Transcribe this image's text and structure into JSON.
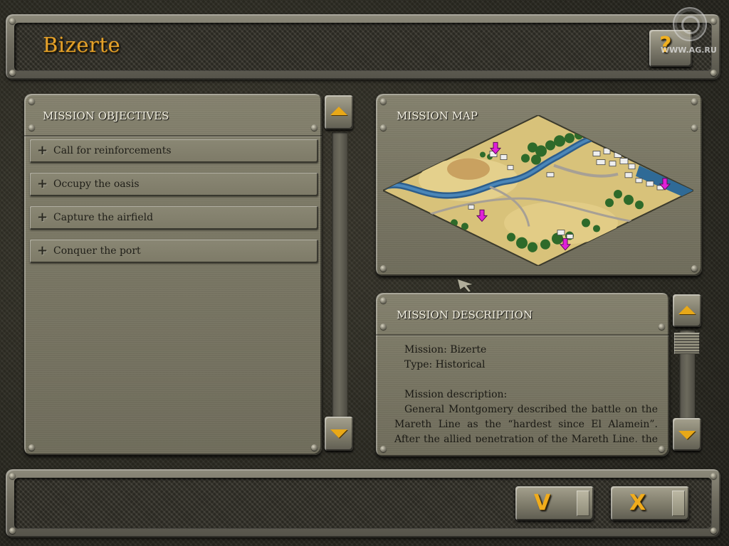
{
  "header": {
    "title": "Bizerte",
    "help_glyph": "?"
  },
  "watermark": {
    "text": "WWW.AG.RU",
    "logo_icon": "ag-logo-icon"
  },
  "objectives": {
    "heading": "MISSION OBJECTIVES",
    "items": [
      {
        "label": "Call for reinforcements"
      },
      {
        "label": "Occupy the oasis"
      },
      {
        "label": "Capture the airfield"
      },
      {
        "label": "Conquer the port"
      }
    ],
    "expand_glyph": "+"
  },
  "map": {
    "heading": "MISSION MAP",
    "markers_color": "#e020d8"
  },
  "description": {
    "heading": "MISSION DESCRIPTION",
    "mission_line": "Mission: Bizerte",
    "type_line": "Type: Historical",
    "desc_label": "Mission description:",
    "body_line1": "General Montgomery described the battle on the",
    "body_line2": "Mareth Line as the “hardest since El Alamein”.",
    "body_line3": "After the allied penetration of the Mareth Line, the"
  },
  "footer": {
    "confirm_glyph": "V",
    "cancel_glyph": "X"
  },
  "colors": {
    "accent": "#e4a12a",
    "panel": "#7c7966",
    "frame": "#6f6c5f"
  }
}
